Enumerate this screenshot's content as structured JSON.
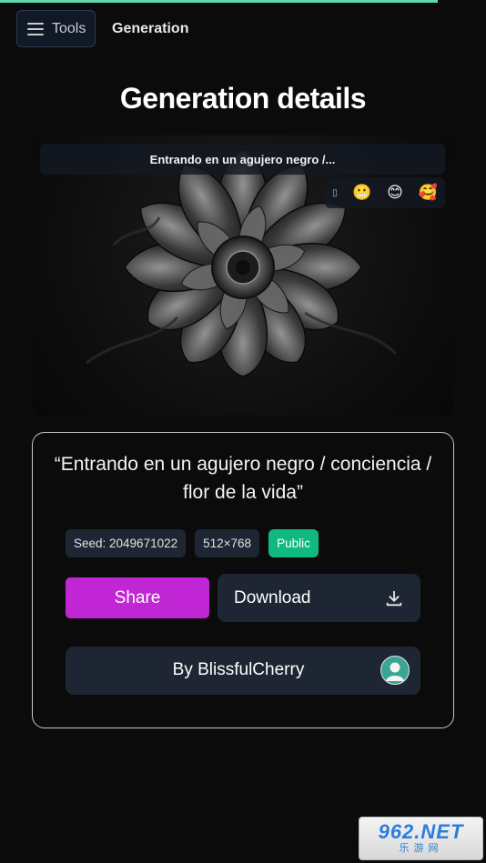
{
  "header": {
    "tools_label": "Tools",
    "breadcrumb": "Generation"
  },
  "page_title": "Generation details",
  "image": {
    "caption": "Entrando en un agujero negro /...",
    "reactions": [
      "😬",
      "😊",
      "🥰"
    ]
  },
  "details": {
    "prompt": "“Entrando en un agujero negro / conciencia / flor de la vida”",
    "seed": "Seed: 2049671022",
    "size": "512×768",
    "visibility": "Public",
    "share_label": "Share",
    "download_label": "Download",
    "author_label": "By BlissfulCherry"
  },
  "colors": {
    "accent": "#c026d3",
    "public_badge": "#10b981",
    "panel": "#1e2633",
    "progress": "#5fd7b0"
  },
  "watermark": {
    "line1": "962.NET",
    "line2": "乐游网"
  }
}
